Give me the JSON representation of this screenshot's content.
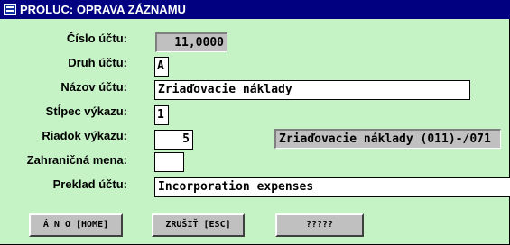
{
  "window": {
    "title": "PROLUC: OPRAVA ZÁZNAMU"
  },
  "form": {
    "cislo_uctu": {
      "label": "Číslo účtu:",
      "value": "11,0000"
    },
    "druh_uctu": {
      "label": "Druh účtu:",
      "value": "A"
    },
    "nazov_uctu": {
      "label": "Názov účtu:",
      "value": "Zriaďovacie náklady"
    },
    "stlpec_vykazu": {
      "label": "Stĺpec výkazu:",
      "value": "1"
    },
    "riadok_vykazu": {
      "label": "Riadok výkazu:",
      "value": "5",
      "description": "Zriaďovacie náklady (011)-/071"
    },
    "zahranicna_mena": {
      "label": "Zahraničná mena:",
      "value": ""
    },
    "preklad_uctu": {
      "label": "Preklad účtu:",
      "value": "Incorporation expenses"
    }
  },
  "buttons": {
    "ano": "Á N O [HOME]",
    "zrusit": "ZRUŠIŤ [ESC]",
    "extra": "?????"
  }
}
